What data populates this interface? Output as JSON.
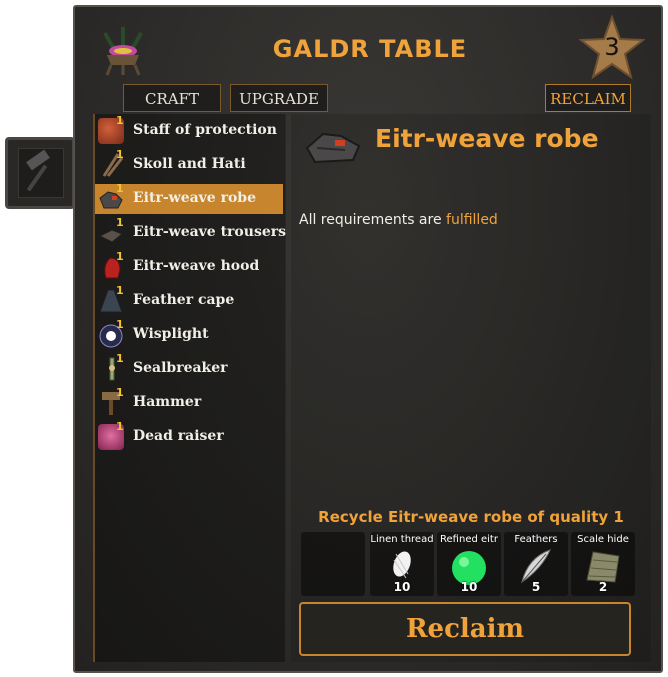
{
  "station": {
    "title": "GALDR TABLE",
    "level": "3"
  },
  "tabs": {
    "craft": "CRAFT",
    "upgrade": "UPGRADE",
    "reclaim": "RECLAIM"
  },
  "recipes": [
    {
      "name": "Staff of protection",
      "quality": "1",
      "icon": "staff-icon",
      "color": "#b5432a"
    },
    {
      "name": "Skoll and Hati",
      "quality": "1",
      "icon": "knives-icon",
      "color": "#5a4632"
    },
    {
      "name": "Eitr-weave robe",
      "quality": "1",
      "icon": "robe-icon",
      "color": "#4a4848",
      "selected": true
    },
    {
      "name": "Eitr-weave trousers",
      "quality": "1",
      "icon": "trousers-icon",
      "color": "#4a4440"
    },
    {
      "name": "Eitr-weave hood",
      "quality": "1",
      "icon": "hood-icon",
      "color": "#b8231f"
    },
    {
      "name": "Feather cape",
      "quality": "1",
      "icon": "cape-icon",
      "color": "#3b4550"
    },
    {
      "name": "Wisplight",
      "quality": "1",
      "icon": "wisp-icon",
      "color": "#6d7fe0"
    },
    {
      "name": "Sealbreaker",
      "quality": "1",
      "icon": "key-icon",
      "color": "#8a9a6a"
    },
    {
      "name": "Hammer",
      "quality": "1",
      "icon": "hammer-icon",
      "color": "#7a5330"
    },
    {
      "name": "Dead raiser",
      "quality": "1",
      "icon": "staff-icon",
      "color": "#c2407a"
    }
  ],
  "detail": {
    "title": "Eitr-weave robe",
    "requirements_prefix": "All requirements are",
    "requirements_status": "fulfilled",
    "recycle_label": "Recycle Eitr-weave robe of quality 1",
    "reclaim_button": "Reclaim"
  },
  "materials": [
    {
      "name": "Linen thread",
      "count": "10",
      "icon": "thread-icon"
    },
    {
      "name": "Refined eitr",
      "count": "10",
      "icon": "eitr-icon"
    },
    {
      "name": "Feathers",
      "count": "5",
      "icon": "feather-icon"
    },
    {
      "name": "Scale hide",
      "count": "2",
      "icon": "scale-hide-icon"
    }
  ],
  "colors": {
    "accent": "#f0a33a",
    "selected": "#c7862d",
    "panel": "#2c2b29"
  }
}
